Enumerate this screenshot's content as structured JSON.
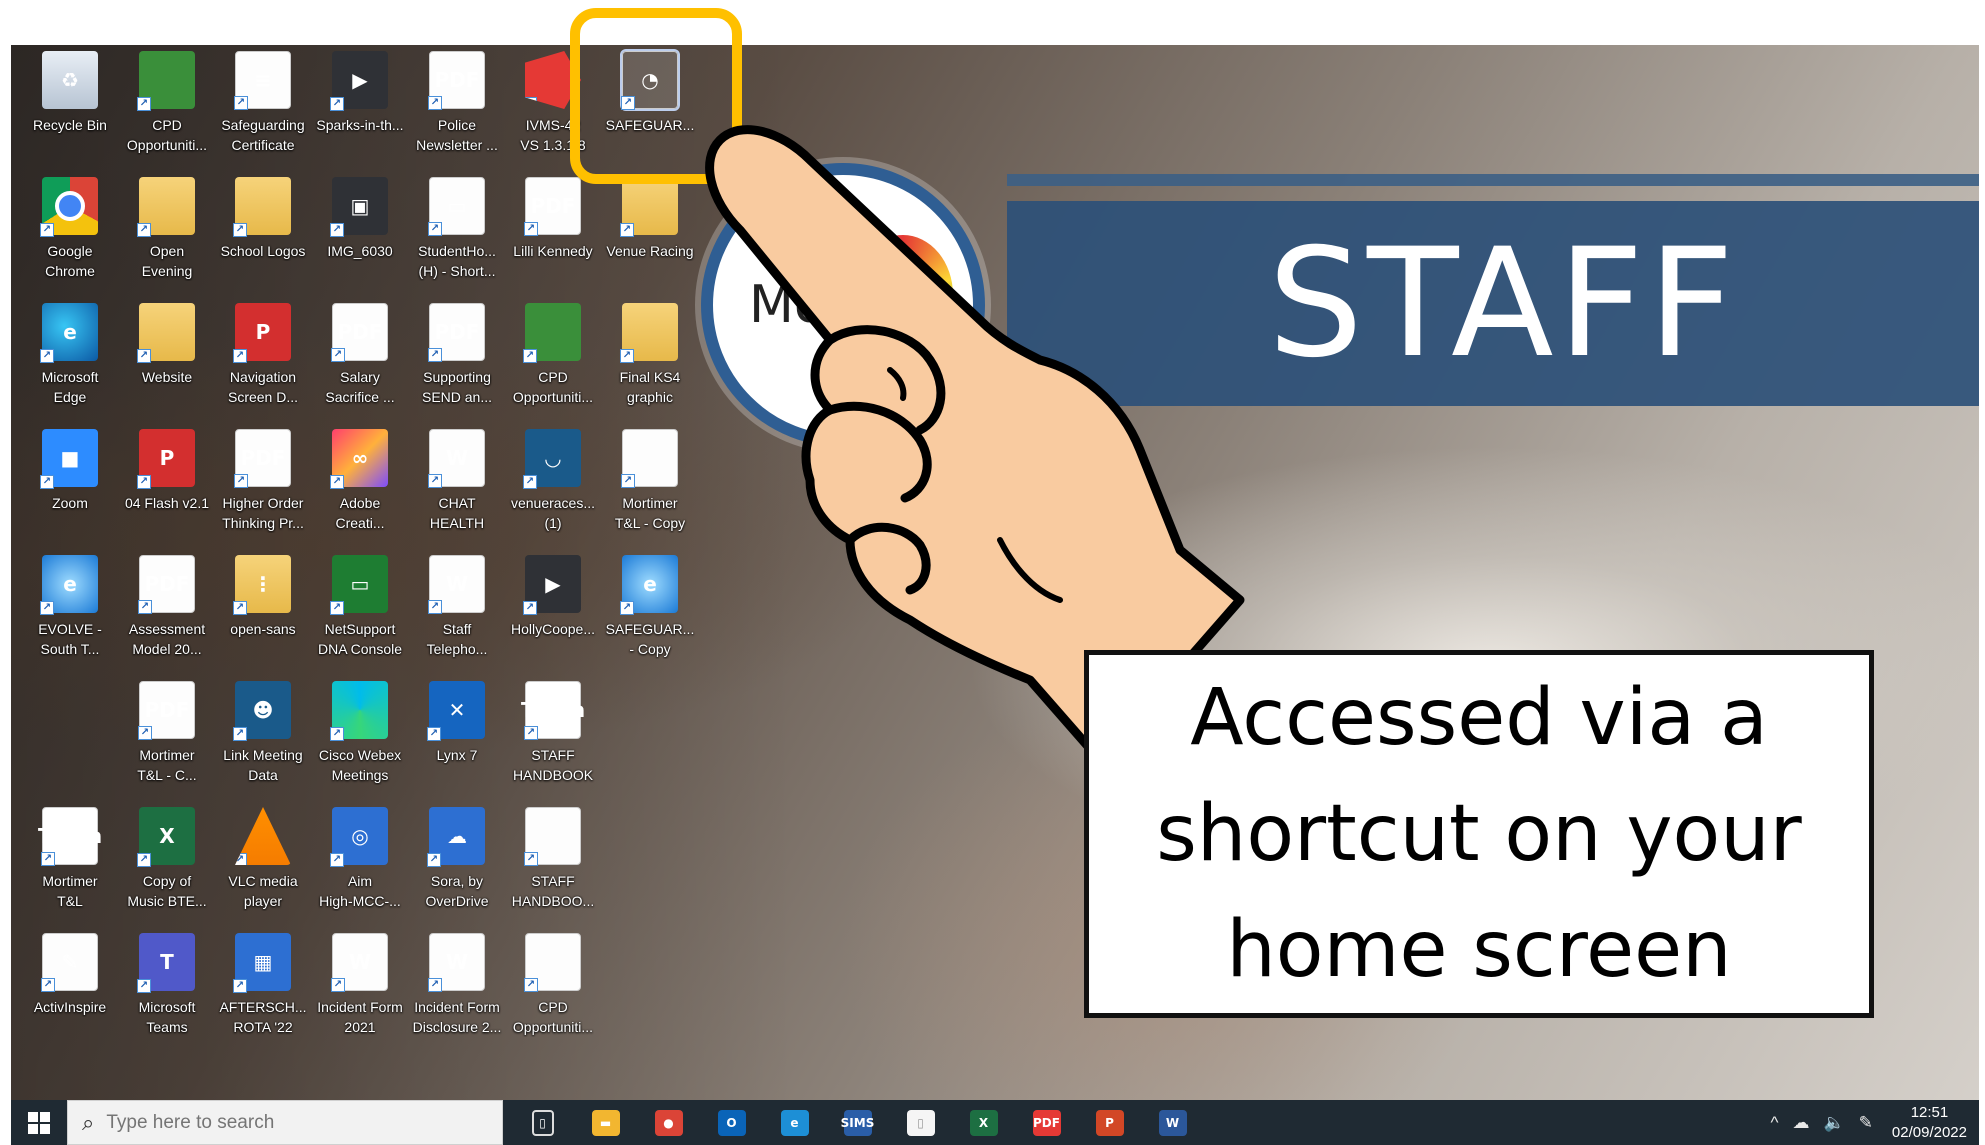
{
  "desktop": {
    "icons": [
      {
        "label": "Recycle Bin",
        "icon": "recycle-bin-icon"
      },
      {
        "label": "CPD\nOpportuniti...",
        "icon": "person-pen-icon"
      },
      {
        "label": "Safeguarding\nCertificate",
        "icon": "certificate-document-icon"
      },
      {
        "label": "Sparks-in-th...",
        "icon": "video-file-icon"
      },
      {
        "label": "Police\nNewsletter ...",
        "icon": "pdf-document-icon"
      },
      {
        "label": "IVMS-42\nVS 1.3.1.8",
        "icon": "ivms-app-icon"
      },
      {
        "label": "SAFEGUAR...",
        "icon": "mortimer-shortcut-icon"
      },
      {
        "label": "Google\nChrome",
        "icon": "chrome-icon"
      },
      {
        "label": "Open\nEvening",
        "icon": "folder-icon"
      },
      {
        "label": "School Logos",
        "icon": "folder-icon"
      },
      {
        "label": "IMG_6030",
        "icon": "photo-icon"
      },
      {
        "label": "StudentHo...\n(H) - Short...",
        "icon": "network-drive-icon"
      },
      {
        "label": "Lilli Kennedy",
        "icon": "pdf-document-icon"
      },
      {
        "label": "Venue Racing",
        "icon": "folder-icon"
      },
      {
        "label": "Microsoft\nEdge",
        "icon": "edge-icon"
      },
      {
        "label": "Website",
        "icon": "folder-icon"
      },
      {
        "label": "Navigation\nScreen D...",
        "icon": "powerpoint-file-icon"
      },
      {
        "label": "Salary\nSacrifice ...",
        "icon": "pdf-document-icon"
      },
      {
        "label": "Supporting\nSEND an...",
        "icon": "pdf-document-icon"
      },
      {
        "label": "CPD\nOpportuniti...",
        "icon": "person-pen-icon"
      },
      {
        "label": "Final KS4\ngraphic",
        "icon": "folder-icon"
      },
      {
        "label": "Zoom",
        "icon": "zoom-icon"
      },
      {
        "label": "04 Flash v2.1",
        "icon": "powerpoint-file-icon"
      },
      {
        "label": "Higher Order\nThinking Pr...",
        "icon": "pdf-document-icon"
      },
      {
        "label": "Adobe\nCreati...",
        "icon": "adobe-cloud-icon"
      },
      {
        "label": "CHAT\nHEALTH",
        "icon": "word-document-icon"
      },
      {
        "label": "venueraces...\n(1)",
        "icon": "app-window-icon"
      },
      {
        "label": "Mortimer\nT&L - Copy",
        "icon": "blank-file-icon"
      },
      {
        "label": "EVOLVE -\nSouth T...",
        "icon": "internet-explorer-icon"
      },
      {
        "label": "Assessment\nModel 20...",
        "icon": "pdf-document-icon"
      },
      {
        "label": "open-sans",
        "icon": "zip-folder-icon"
      },
      {
        "label": "NetSupport\nDNA Console",
        "icon": "netsupport-icon"
      },
      {
        "label": "Staff\nTelepho...",
        "icon": "word-document-icon"
      },
      {
        "label": "HollyCoope...",
        "icon": "video-file-icon"
      },
      {
        "label": "SAFEGUAR...\n- Copy",
        "icon": "internet-explorer-icon"
      },
      {
        "label": "Mortimer\nT&L - C...",
        "icon": "pdf-document-icon"
      },
      {
        "label": "Link Meeting\nData",
        "icon": "people-icon"
      },
      {
        "label": "Cisco Webex\nMeetings",
        "icon": "webex-icon"
      },
      {
        "label": "Lynx 7",
        "icon": "lynx-icon"
      },
      {
        "label": "STAFF\nHANDBOOK",
        "icon": "teach-handbook-icon"
      },
      {
        "label": "Mortimer\nT&L",
        "icon": "teach-learn-icon"
      },
      {
        "label": "Copy of\nMusic BTE...",
        "icon": "excel-file-icon"
      },
      {
        "label": "VLC media\nplayer",
        "icon": "vlc-icon"
      },
      {
        "label": "Aim\nHigh-MCC-...",
        "icon": "target-icon"
      },
      {
        "label": "Sora, by\nOverDrive",
        "icon": "sora-icon"
      },
      {
        "label": "STAFF\nHANDBOO...",
        "icon": "blank-file-icon"
      },
      {
        "label": "ActivInspire",
        "icon": "activinspire-icon"
      },
      {
        "label": "Microsoft\nTeams",
        "icon": "teams-icon"
      },
      {
        "label": "AFTERSCH...\nROTA '22",
        "icon": "calendar-file-icon"
      },
      {
        "label": "Incident Form\n2021",
        "icon": "word-document-icon"
      },
      {
        "label": "Incident Form\nDisclosure 2...",
        "icon": "word-document-icon"
      },
      {
        "label": "CPD\nOpportuniti...",
        "icon": "blank-file-icon"
      }
    ]
  },
  "banner": {
    "title": "STAFF",
    "logo_text": "Mo"
  },
  "callout": {
    "text": "Accessed via a\nshortcut on your\nhome screen"
  },
  "taskbar": {
    "search_placeholder": "Type here to search",
    "apps": [
      {
        "name": "task-view",
        "glyph": "▯",
        "color": "#1f2a33"
      },
      {
        "name": "file-explorer",
        "glyph": "▬",
        "color": "#f2b630"
      },
      {
        "name": "chrome",
        "glyph": "●",
        "color": "#db4437"
      },
      {
        "name": "outlook",
        "glyph": "O",
        "color": "#0a64b8"
      },
      {
        "name": "edge",
        "glyph": "e",
        "color": "#1d8fd6"
      },
      {
        "name": "sims",
        "glyph": "SIMS",
        "color": "#2a5ea8"
      },
      {
        "name": "file",
        "glyph": "▯",
        "color": "#f5f5f5"
      },
      {
        "name": "excel",
        "glyph": "X",
        "color": "#1d6f42"
      },
      {
        "name": "pdf-reader",
        "glyph": "PDF",
        "color": "#e53935"
      },
      {
        "name": "powerpoint",
        "glyph": "P",
        "color": "#d24726"
      },
      {
        "name": "word",
        "glyph": "W",
        "color": "#2b579a"
      }
    ],
    "tray": {
      "chevron": "^",
      "clock_time": "12:51",
      "clock_date": "02/09/2022"
    }
  },
  "colors": {
    "highlight": "#ffc000",
    "banner": "#2c5078",
    "taskbar": "#1f2a33"
  }
}
